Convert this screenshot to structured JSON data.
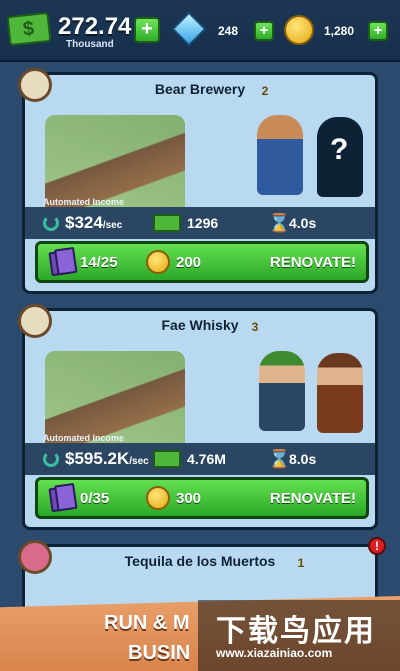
{
  "topbar": {
    "cash_value": "272.74",
    "cash_unit": "Thousand",
    "gems": "248",
    "coins": "1,280"
  },
  "cards": [
    {
      "name": "Bear Brewery",
      "level": "2",
      "auto_label": "Automated Income",
      "auto_value": "$324",
      "auto_unit": "/sec",
      "cash_stat": "1296",
      "time_stat": "4.0s",
      "progress": "14/25",
      "cost": "200",
      "action": "RENOVATE!",
      "locked_char": "?"
    },
    {
      "name": "Fae Whisky",
      "level": "3",
      "auto_label": "Automated Income",
      "auto_value": "$595.2K",
      "auto_unit": "/sec",
      "cash_stat": "4.76M",
      "time_stat": "8.0s",
      "progress": "0/35",
      "cost": "300",
      "action": "RENOVATE!"
    },
    {
      "name": "Tequila de los Muertos",
      "level": "1",
      "alert": "!"
    }
  ],
  "banner": {
    "line1": "RUN & M",
    "line2": "BUSIN"
  },
  "watermark": {
    "title": "下载鸟应用",
    "url": "www.xiazainiao.com"
  },
  "icons": [
    "cash-icon",
    "gem-icon",
    "coin-icon",
    "refresh-icon",
    "hourglass-icon",
    "card-icon"
  ],
  "colors": {
    "accent_green": "#2ca829",
    "panel_blue": "#b8d9ef",
    "stats_bar": "#2a4662"
  }
}
